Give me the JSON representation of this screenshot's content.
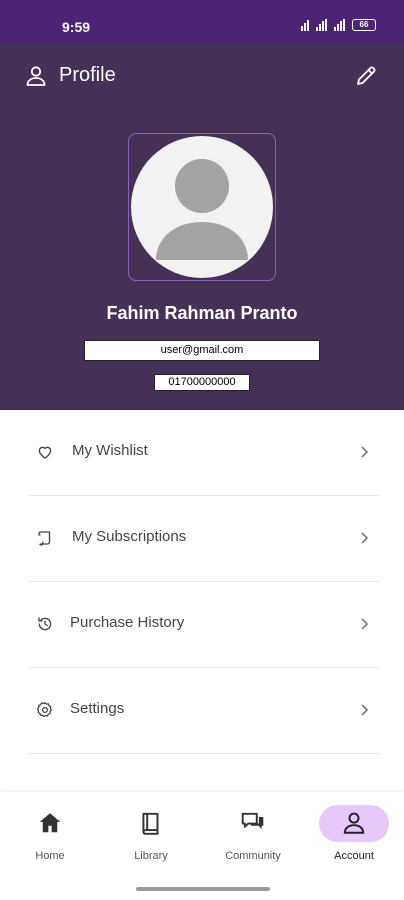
{
  "status_bar": {
    "time": "9:59",
    "battery": "66"
  },
  "header": {
    "title": "Profile"
  },
  "user": {
    "name": "Fahim Rahman Pranto",
    "email": "user@gmail.com",
    "phone": "01700000000"
  },
  "menu": [
    {
      "label": "My Wishlist",
      "icon": "heart-icon"
    },
    {
      "label": "My Subscriptions",
      "icon": "subscriptions-icon"
    },
    {
      "label": "Purchase History",
      "icon": "history-icon"
    },
    {
      "label": "Settings",
      "icon": "gear-icon"
    }
  ],
  "bottom_nav": {
    "items": [
      {
        "label": "Home",
        "icon": "home-icon"
      },
      {
        "label": "Library",
        "icon": "book-icon"
      },
      {
        "label": "Community",
        "icon": "chat-icon"
      },
      {
        "label": "Account",
        "icon": "person-icon",
        "active": true
      }
    ]
  },
  "colors": {
    "status_bar": "#4b2475",
    "header_bg": "#463156",
    "avatar_border": "#8a63c2",
    "active_nav_pill": "#e6c9fa"
  }
}
